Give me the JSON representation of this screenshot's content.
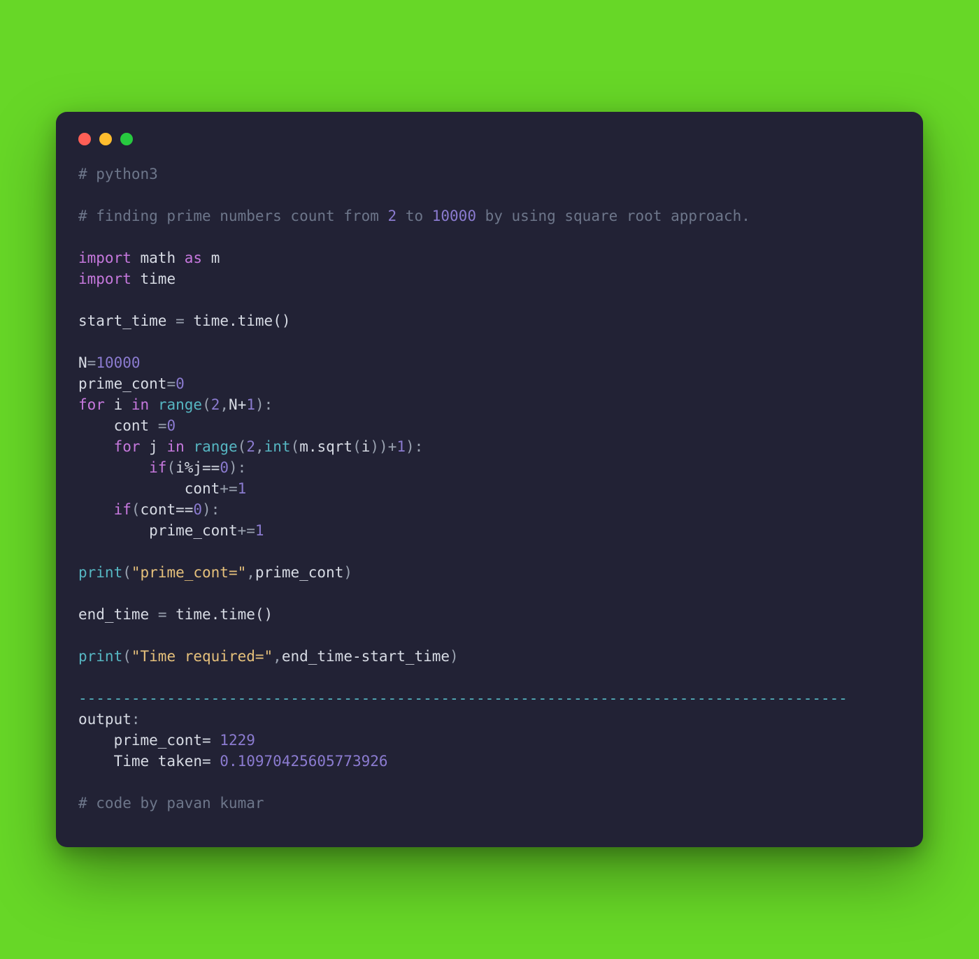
{
  "window": {
    "bg": "#222235"
  },
  "code": {
    "c_python3": "# python3",
    "c_desc_1": "# finding prime numbers count from ",
    "c_desc_n2": "2",
    "c_desc_2": " to ",
    "c_desc_n10000": "10000",
    "c_desc_3": " by using square root approach.",
    "kw_import1": "import",
    "id_math": "math",
    "kw_as": "as",
    "id_m": "m",
    "kw_import2": "import",
    "id_time_mod": "time",
    "id_start_time": "start_time",
    "op_eq1": "=",
    "call_time_time1": "time.time()",
    "id_N": "N",
    "op_eq2": "=",
    "lit_10000": "10000",
    "id_prime_cont": "prime_cont",
    "op_eq3": "=",
    "lit_0a": "0",
    "kw_for1": "for",
    "id_i": "i",
    "kw_in1": "in",
    "fn_range1": "range",
    "paren_open1": "(",
    "lit_2a": "2",
    "comma1": ",",
    "id_Nplus1": "N+",
    "lit_1a": "1",
    "paren_close1": ")",
    "colon1": ":",
    "id_cont": "cont",
    "op_eq4": "=",
    "lit_0b": "0",
    "kw_for2": "for",
    "id_j": "j",
    "kw_in2": "in",
    "fn_range2": "range",
    "paren_open2": "(",
    "lit_2b": "2",
    "comma2": ",",
    "fn_int": "int",
    "paren_open3": "(",
    "id_msqrt": "m.sqrt",
    "paren_open4": "(",
    "id_i2": "i",
    "paren_close4": ")",
    "paren_close3": ")",
    "plus": "+",
    "lit_1b": "1",
    "paren_close2": ")",
    "colon2": ":",
    "kw_if1": "if",
    "paren_open5": "(",
    "cond1": "i%j==",
    "lit_0c": "0",
    "paren_close5": ")",
    "colon3": ":",
    "id_cont2": "cont",
    "op_pluseq1": "+=",
    "lit_1c": "1",
    "kw_if2": "if",
    "paren_open6": "(",
    "cond2": "cont==",
    "lit_0d": "0",
    "paren_close6": ")",
    "colon4": ":",
    "id_prime_cont2": "prime_cont",
    "op_pluseq2": "+=",
    "lit_1d": "1",
    "fn_print1": "print",
    "paren_open7": "(",
    "str1": "\"prime_cont=\"",
    "comma3": ",",
    "id_prime_cont3": "prime_cont",
    "paren_close7": ")",
    "id_end_time": "end_time",
    "op_eq5": "=",
    "call_time_time2": "time.time()",
    "fn_print2": "print",
    "paren_open8": "(",
    "str2": "\"Time required=\"",
    "comma4": ",",
    "expr_diff": "end_time-start_time",
    "paren_close8": ")",
    "dashes": "---------------------------------------------------------------------------------------",
    "lbl_output": "output",
    "colon5": ":",
    "out_line1_a": "    prime_cont= ",
    "out_line1_b": "1229",
    "out_line2_a": "    Time taken= ",
    "out_line2_b": "0.10970425605773926",
    "c_author": "# code by pavan kumar"
  }
}
